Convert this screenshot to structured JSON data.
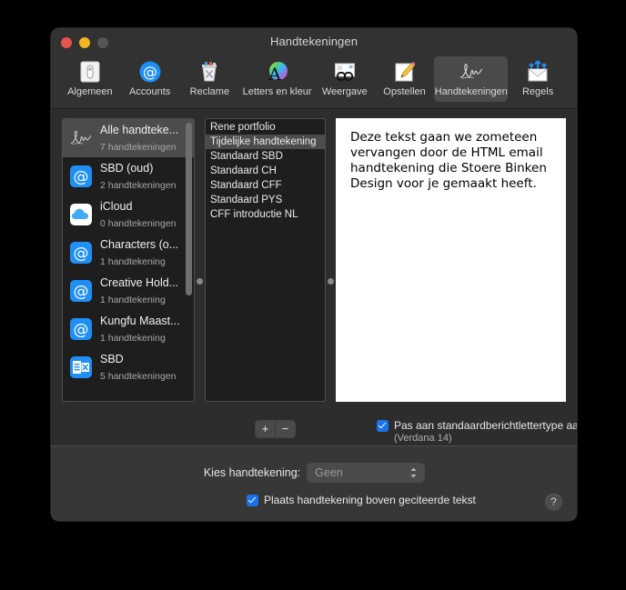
{
  "window": {
    "title": "Handtekeningen",
    "traffic_lights": [
      "close-button",
      "minimize-button",
      "maximize-button"
    ]
  },
  "toolbar": {
    "items": [
      {
        "label": "Algemeen",
        "icon": "general-switch-icon",
        "selected": false
      },
      {
        "label": "Accounts",
        "icon": "at-sign-icon",
        "selected": false
      },
      {
        "label": "Reclame",
        "icon": "junk-trash-icon",
        "selected": false
      },
      {
        "label": "Letters en kleur",
        "icon": "fonts-colors-icon",
        "selected": false
      },
      {
        "label": "Weergave",
        "icon": "viewing-glasses-icon",
        "selected": false
      },
      {
        "label": "Opstellen",
        "icon": "composing-pencil-icon",
        "selected": false
      },
      {
        "label": "Handtekeningen",
        "icon": "signature-icon",
        "selected": true
      },
      {
        "label": "Regels",
        "icon": "rules-envelope-icon",
        "selected": false
      }
    ]
  },
  "accounts": {
    "items": [
      {
        "name": "Alle handteke...",
        "count": "7 handtekeningen",
        "icon": "signature-icon",
        "selected": true
      },
      {
        "name": "SBD (oud)",
        "count": "2 handtekeningen",
        "icon": "at-sign-icon",
        "selected": false
      },
      {
        "name": "iCloud",
        "count": "0 handtekeningen",
        "icon": "icloud-icon",
        "selected": false
      },
      {
        "name": "Characters (o...",
        "count": "1 handtekening",
        "icon": "at-sign-icon",
        "selected": false
      },
      {
        "name": "Creative Hold...",
        "count": "1 handtekening",
        "icon": "at-sign-icon",
        "selected": false
      },
      {
        "name": "Kungfu Maast...",
        "count": "1 handtekening",
        "icon": "at-sign-icon",
        "selected": false
      },
      {
        "name": "SBD",
        "count": "5 handtekeningen",
        "icon": "exchange-icon",
        "selected": false
      }
    ]
  },
  "signature_list": {
    "items": [
      {
        "label": "Rene portfolio",
        "selected": false
      },
      {
        "label": "Tijdelijke handtekening",
        "selected": true
      },
      {
        "label": "Standaard SBD",
        "selected": false
      },
      {
        "label": "Standaard CH",
        "selected": false
      },
      {
        "label": "Standaard CFF",
        "selected": false
      },
      {
        "label": "Standaard PYS",
        "selected": false
      },
      {
        "label": "CFF introductie NL",
        "selected": false
      }
    ]
  },
  "editor": {
    "text": "Deze tekst gaan we zometeen vervangen door de HTML email handtekening die Stoere Binken Design voor je gemaakt heeft."
  },
  "controls": {
    "add_label": "+",
    "remove_label": "−",
    "default_font_checkbox": {
      "label": "Pas aan standaardberichtlettertype aan",
      "sublabel": "(Verdana 14)",
      "checked": true
    }
  },
  "bottom": {
    "chooser_label": "Kies handtekening:",
    "chooser_value": "Geen",
    "quote_checkbox": {
      "label": "Plaats handtekening boven geciteerde tekst",
      "checked": true
    },
    "help_label": "?"
  },
  "colors": {
    "window_bg": "#2d2d2d",
    "titlebar_bg": "#323232",
    "accent_blue": "#1a73e8",
    "selection": "#4c4c4c",
    "editor_bg": "#ffffff"
  }
}
